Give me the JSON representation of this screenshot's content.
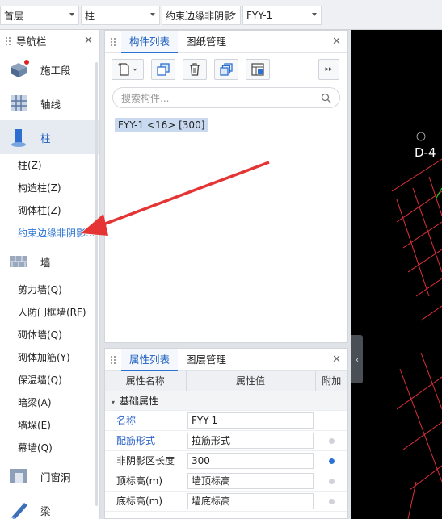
{
  "topbar": {
    "floor": "首层",
    "category": "柱",
    "subcategory": "约束边缘非阴影",
    "component": "FYY-1"
  },
  "nav": {
    "title": "导航栏",
    "categories": {
      "construction": "施工段",
      "axis": "轴线",
      "column": "柱",
      "wall": "墙",
      "opening": "门窗洞",
      "beam": "梁"
    },
    "column_items": [
      "柱(Z)",
      "构造柱(Z)",
      "砌体柱(Z)",
      "约束边缘非阴影..."
    ],
    "wall_items": [
      "剪力墙(Q)",
      "人防门框墙(RF)",
      "砌体墙(Q)",
      "砌体加筋(Y)",
      "保温墙(Q)",
      "暗梁(A)",
      "墙垛(E)",
      "幕墙(Q)"
    ]
  },
  "component_panel": {
    "tabs": [
      "构件列表",
      "图纸管理"
    ],
    "search_placeholder": "搜索构件...",
    "items": [
      "FYY-1 <16> [300]"
    ]
  },
  "property_panel": {
    "tabs": [
      "属性列表",
      "图层管理"
    ],
    "headers": [
      "属性名称",
      "属性值",
      "附加"
    ],
    "group": "基础属性",
    "rows": [
      {
        "name": "名称",
        "value": "FYY-1",
        "blue": true,
        "dot": "none"
      },
      {
        "name": "配筋形式",
        "value": "拉筋形式",
        "blue": true,
        "dot": "off"
      },
      {
        "name": "非阴影区长度",
        "value": "300",
        "blue": false,
        "dot": "on"
      },
      {
        "name": "顶标高(m)",
        "value": "墙顶标高",
        "blue": false,
        "dot": "off"
      },
      {
        "name": "底标高(m)",
        "value": "墙底标高",
        "blue": false,
        "dot": "off"
      }
    ]
  },
  "viewport": {
    "axis_label": "D-4",
    "background": "#000000",
    "grid_color": "#e0303a",
    "accent_color": "#19c919"
  },
  "annotation_color": "#e53434"
}
